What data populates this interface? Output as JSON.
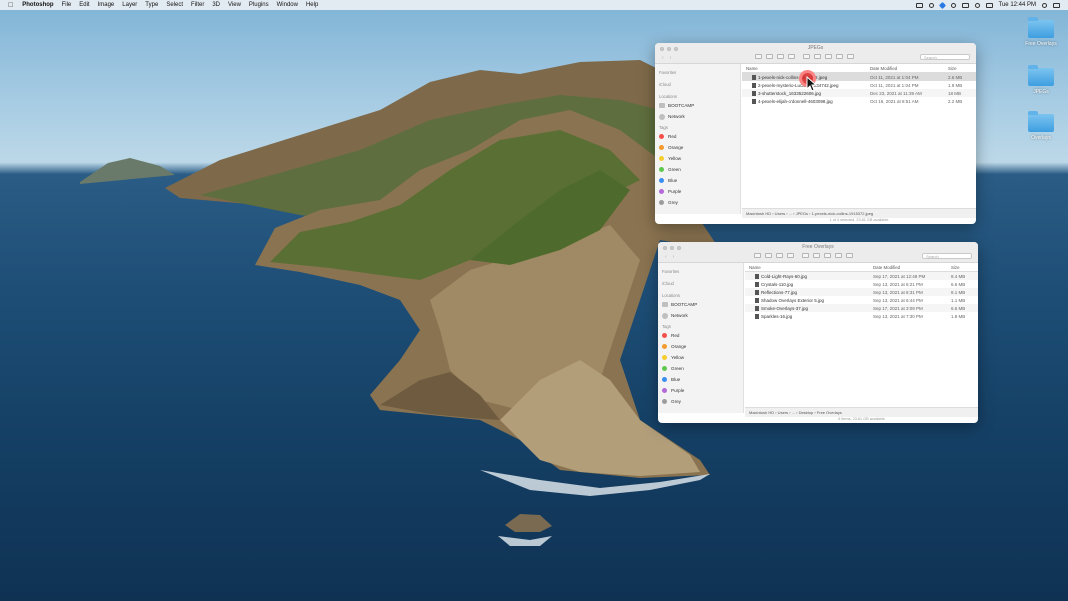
{
  "menubar": {
    "app_name": "Photoshop",
    "menus": [
      "File",
      "Edit",
      "Image",
      "Layer",
      "Type",
      "Select",
      "Filter",
      "3D",
      "View",
      "Plugins",
      "Window",
      "Help"
    ],
    "clock": "Tue 12:44 PM"
  },
  "desktop_folders": [
    {
      "label": "Free Overlays"
    },
    {
      "label": "JPEGs"
    },
    {
      "label": "Overlays"
    }
  ],
  "window_jpegs": {
    "title": "JPEGs",
    "search_placeholder": "Search",
    "sidebar": {
      "favorites_label": "Favorites",
      "icloud_label": "iCloud",
      "locations_label": "Locations",
      "locations": [
        "BOOTCAMP",
        "Network"
      ],
      "tags_label": "Tags",
      "tags": [
        {
          "label": "Red",
          "color": "#f4504b"
        },
        {
          "label": "Orange",
          "color": "#f59a2f"
        },
        {
          "label": "Yellow",
          "color": "#f5cd2f"
        },
        {
          "label": "Green",
          "color": "#5ec84e"
        },
        {
          "label": "Blue",
          "color": "#3a8ef2"
        },
        {
          "label": "Purple",
          "color": "#b26ad8"
        },
        {
          "label": "Grey",
          "color": "#9c9c9c"
        }
      ]
    },
    "columns": {
      "name": "Name",
      "date": "Date Modified",
      "size": "Size"
    },
    "files": [
      {
        "name": "1-pexels-nick-collins-1915372.jpeg",
        "date": "Oct 11, 2021 at 1:04 PM",
        "size": "2.6 MB"
      },
      {
        "name": "2-pexels-mysterio-Lucario-1034742.jpeg",
        "date": "Oct 11, 2021 at 1:04 PM",
        "size": "1.9 MB"
      },
      {
        "name": "3-shutterstock_1633522606.jpg",
        "date": "Dec 23, 2021 at 11:39 AM",
        "size": "18 MB"
      },
      {
        "name": "4-pexels-elijah-o'donnell-4603098.jpg",
        "date": "Oct 16, 2021 at 8:51 AM",
        "size": "2.2 MB"
      }
    ],
    "path": "Macintosh HD › Users › ... › JPEGs › 1-pexels-nick-collins-1915372.jpeg",
    "status": "1 of 4 selected, 23.81 GB available"
  },
  "window_overlays": {
    "title": "Free Overlays",
    "search_placeholder": "Search",
    "sidebar": {
      "favorites_label": "Favorites",
      "icloud_label": "iCloud",
      "locations_label": "Locations",
      "locations": [
        "BOOTCAMP",
        "Network"
      ],
      "tags_label": "Tags",
      "tags": [
        {
          "label": "Red",
          "color": "#f4504b"
        },
        {
          "label": "Orange",
          "color": "#f59a2f"
        },
        {
          "label": "Yellow",
          "color": "#f5cd2f"
        },
        {
          "label": "Green",
          "color": "#5ec84e"
        },
        {
          "label": "Blue",
          "color": "#3a8ef2"
        },
        {
          "label": "Purple",
          "color": "#b26ad8"
        },
        {
          "label": "Grey",
          "color": "#9c9c9c"
        }
      ]
    },
    "columns": {
      "name": "Name",
      "date": "Date Modified",
      "size": "Size"
    },
    "files": [
      {
        "name": "Cold-Light-Rays-60.jpg",
        "date": "Sep 17, 2021 at 12:48 PM",
        "size": "8.4 MB"
      },
      {
        "name": "Crystals-110.jpg",
        "date": "Sep 13, 2021 at 6:21 PM",
        "size": "6.6 MB"
      },
      {
        "name": "Reflections-77.jpg",
        "date": "Sep 13, 2021 at 6:31 PM",
        "size": "8.1 MB"
      },
      {
        "name": "Shadow Overlays Exterior 5.jpg",
        "date": "Sep 13, 2021 at 6:44 PM",
        "size": "1.1 MB"
      },
      {
        "name": "Smoke-Overlays-37.jpg",
        "date": "Sep 17, 2021 at 3:09 PM",
        "size": "6.6 MB"
      },
      {
        "name": "Sparkles-16.jpg",
        "date": "Sep 13, 2021 at 7:30 PM",
        "size": "1.8 MB"
      }
    ],
    "path": "Macintosh HD › Users › ... › Desktop › Free Overlays",
    "status": "6 items, 23.81 GB available"
  }
}
